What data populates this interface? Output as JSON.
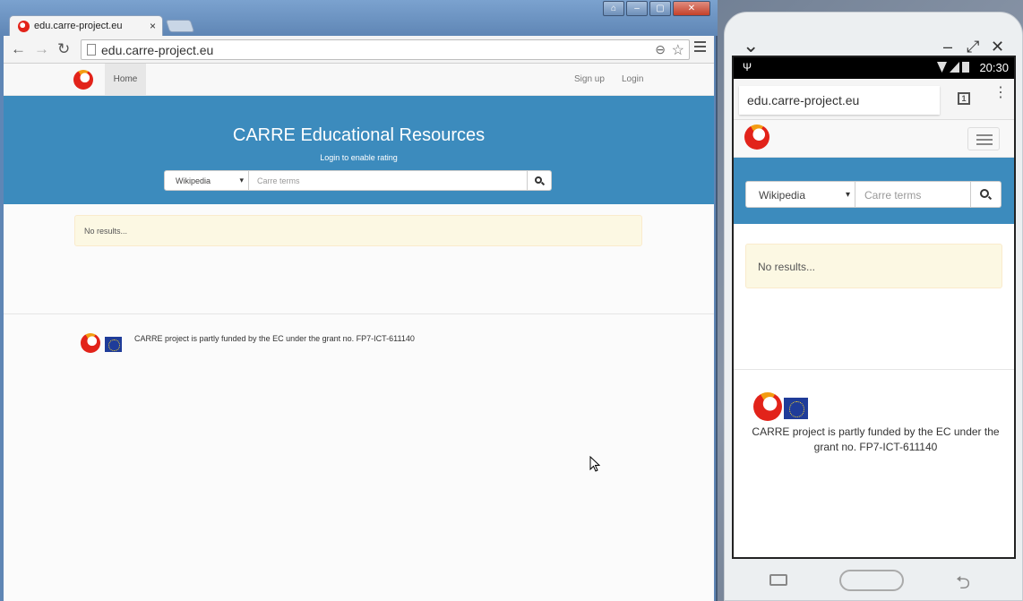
{
  "browser": {
    "tab_title": "edu.carre-project.eu",
    "tab_close": "×",
    "address": "edu.carre-project.eu",
    "back": "←",
    "forward": "→",
    "reload": "↻",
    "zoom": "⊖",
    "star": "☆",
    "min": "‒",
    "max": "▢",
    "close": "✕",
    "user": "⌂"
  },
  "site": {
    "nav": {
      "home": "Home",
      "signup": "Sign up",
      "login": "Login"
    },
    "jumbo": {
      "title": "CARRE Educational Resources",
      "subtitle": "Login to enable rating"
    },
    "search": {
      "source": "Wikipedia",
      "caret": "▾",
      "placeholder": "Carre terms"
    },
    "alert": "No results...",
    "footer": "CARRE project is partly funded by the EC under the grant no. FP7-ICT-611140"
  },
  "phone": {
    "controls": {
      "collapse": "⌄",
      "minimize": "–",
      "expand": "⤢",
      "close": "✕"
    },
    "status": {
      "usb": "Ψ",
      "time": "20:30"
    },
    "url": "edu.carre-project.eu",
    "tabs_count": "1",
    "more": "⋮",
    "back": "⮌"
  },
  "colors": {
    "jumbotron": "#3c8bbd",
    "alert_bg": "#fcf8e3",
    "brand_red": "#e2231a"
  }
}
